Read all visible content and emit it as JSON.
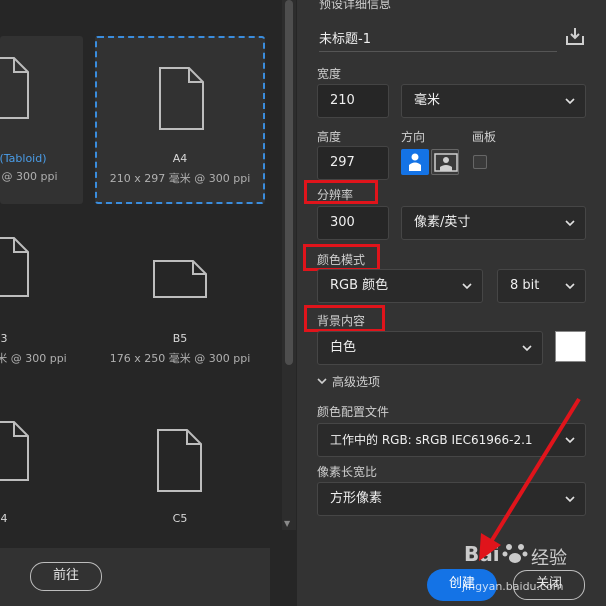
{
  "presets": {
    "items": [
      {
        "title": "(Tabloid)",
        "sub": "@ 300 ppi"
      },
      {
        "title": "A4",
        "sub": "210 x 297 毫米 @ 300 ppi"
      },
      {
        "title": "3",
        "sub": "米 @ 300 ppi"
      },
      {
        "title": "B5",
        "sub": "176 x 250 毫米 @ 300 ppi"
      },
      {
        "title": "4",
        "sub": ""
      },
      {
        "title": "C5",
        "sub": ""
      }
    ],
    "back_button": "前往"
  },
  "details": {
    "section_title": "预设详细信息",
    "doc_name": "未标题-1",
    "width_label": "宽度",
    "width_value": "210",
    "unit_value": "毫米",
    "height_label": "高度",
    "height_value": "297",
    "orientation_label": "方向",
    "artboard_label": "画板",
    "resolution_label": "分辨率",
    "resolution_value": "300",
    "resolution_unit": "像素/英寸",
    "color_mode_label": "颜色模式",
    "color_mode_value": "RGB 颜色",
    "bit_depth_value": "8 bit",
    "background_label": "背景内容",
    "background_value": "白色",
    "advanced_label": "高级选项",
    "color_profile_label": "颜色配置文件",
    "color_profile_value": "工作中的 RGB: sRGB IEC61966-2.1",
    "pixel_aspect_label": "像素长宽比",
    "pixel_aspect_value": "方形像素"
  },
  "actions": {
    "create_label": "创建",
    "close_label": "关闭"
  },
  "watermark": {
    "text1": "Bai",
    "text2": "经验",
    "text3": "jingyan.baidu.com"
  },
  "colors": {
    "accent": "#1473e6",
    "highlight": "#e0141b",
    "selection_border": "#3a8dde"
  }
}
